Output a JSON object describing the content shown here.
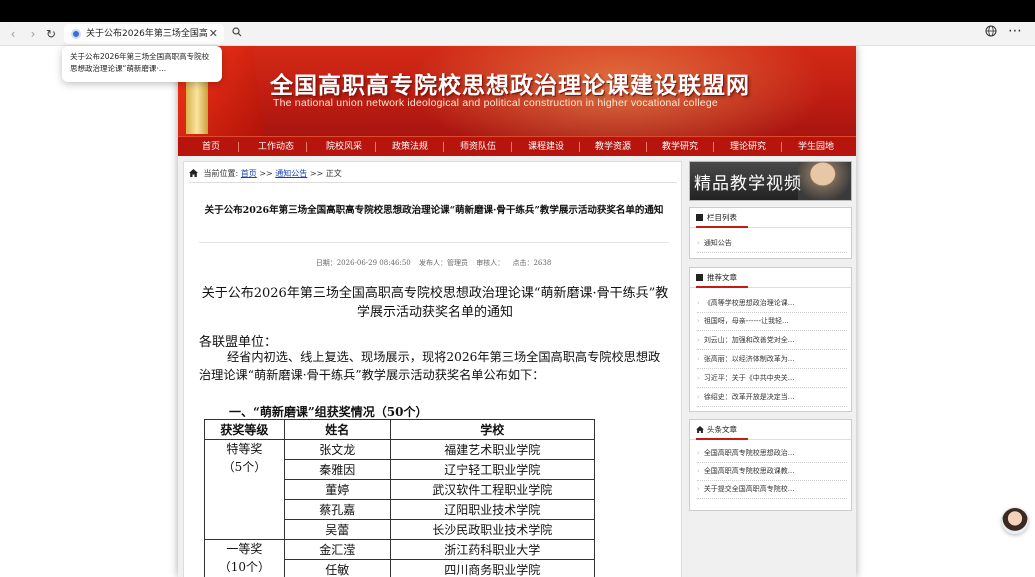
{
  "browser": {
    "tab_title": "关于公布2026年第三场全国高",
    "tooltip": "关于公布2026年第三场全国高职高专院校思想政治理论课“萌新磨课·…",
    "icons": {
      "back": "chevron-left-icon",
      "forward": "chevron-right-icon",
      "reload": "reload-icon",
      "search": "search-icon",
      "globe": "globe-icon",
      "more": "more-icon"
    }
  },
  "banner": {
    "title": "全国高职高专院校思想政治理论课建设联盟网",
    "subtitle": "The national union network ideological and political construction in higher vocational college"
  },
  "nav": {
    "items": [
      "首页",
      "工作动态",
      "院校风采",
      "政策法规",
      "师资队伍",
      "课程建设",
      "教学资源",
      "教学研究",
      "理论研究",
      "学生园地"
    ]
  },
  "breadcrumb": {
    "prefix": "当前位置:",
    "home": "首页",
    "sep1": ">>",
    "section": "通知公告",
    "sep2": ">>",
    "current": "正文"
  },
  "article": {
    "title": "关于公布2026年第三场全国高职高专院校思想政治理论课“萌新磨课·骨干练兵”教学展示活动获奖名单的通知",
    "meta": {
      "date": "日期：2026-06-29 08:46:50",
      "publisher": "发布人：管理员",
      "reviewer": "审核人：",
      "clicks": "点击：2638"
    },
    "content_title": "关于公布2026年第三场全国高职高专院校思想政治理论课“萌新磨课·骨干练兵”教学展示活动获奖名单的通知",
    "salutation": "各联盟单位：",
    "paragraph": "经省内初选、线上复选、现场展示，现将2026年第三场全国高职高专院校思想政治理论课“萌新磨课·骨干练兵”教学展示活动获奖名单公布如下：",
    "section_heading": "一、“萌新磨课”组获奖情况（50个）",
    "table": {
      "headers": [
        "获奖等级",
        "姓名",
        "学校"
      ],
      "groups": [
        {
          "grade": "特等奖",
          "count": "（5个）",
          "rows": [
            [
              "张文龙",
              "福建艺术职业学院"
            ],
            [
              "秦雅因",
              "辽宁轻工职业学院"
            ],
            [
              "董婷",
              "武汉软件工程职业学院"
            ],
            [
              "蔡孔嘉",
              "辽阳职业技术学院"
            ],
            [
              "吴蕾",
              "长沙民政职业技术学院"
            ]
          ]
        },
        {
          "grade": "一等奖",
          "count": "（10个）",
          "rows": [
            [
              "金汇滢",
              "浙江药科职业大学"
            ],
            [
              "任敏",
              "四川商务职业学院"
            ]
          ]
        }
      ]
    }
  },
  "sidebar": {
    "video_banner": "精品教学视频",
    "column_list": {
      "title": "栏目列表",
      "items": [
        "通知公告"
      ]
    },
    "recommended": {
      "title": "推荐文章",
      "items": [
        "《高等学校思想政治理论课...",
        "祖国呀，母亲------让我轻...",
        "刘云山：加强和改善党对全...",
        "张高丽：以经济体制改革为...",
        "习近平：关于《中共中央关...",
        "徐绍史：改革开放是决定当..."
      ]
    },
    "headlines": {
      "title": "头条文章",
      "items": [
        "全国高职高专院校思想政治...",
        "全国高职高专院校思政课教...",
        "关于提交全国高职高专院校..."
      ]
    }
  },
  "colors": {
    "brand_red": "#b7140e",
    "link_blue": "#1a3fbb"
  }
}
